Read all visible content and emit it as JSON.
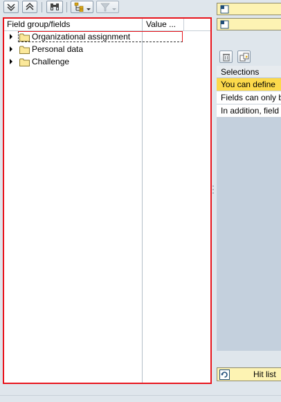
{
  "toolbar": {
    "buttons": [
      {
        "name": "expand-all-button",
        "icon": "expand-all-icon"
      },
      {
        "name": "collapse-all-button",
        "icon": "collapse-all-icon"
      },
      {
        "name": "find-button",
        "icon": "binoculars-icon"
      },
      {
        "name": "hierarchy-button",
        "icon": "hierarchy-icon"
      },
      {
        "name": "filter-button",
        "icon": "filter-icon"
      }
    ]
  },
  "tree": {
    "col_field": "Field group/fields",
    "col_value": "Value ...",
    "nodes": [
      {
        "label": "Organizational assignment"
      },
      {
        "label": "Personal data"
      },
      {
        "label": "Challenge"
      }
    ]
  },
  "right": {
    "top_buttons": [
      {
        "icon": "selection-view-icon"
      },
      {
        "icon": "selection-view-icon"
      }
    ],
    "panel_title": "Selections",
    "rows": [
      {
        "text": "You can define"
      },
      {
        "text": "Fields can only b"
      },
      {
        "text": "In addition, field"
      }
    ],
    "hit_list_label": "Hit list"
  },
  "colors": {
    "focus_border": "#e8131b",
    "selected_row": "#fcd94b",
    "yellow_button": "#fdf3b3"
  }
}
